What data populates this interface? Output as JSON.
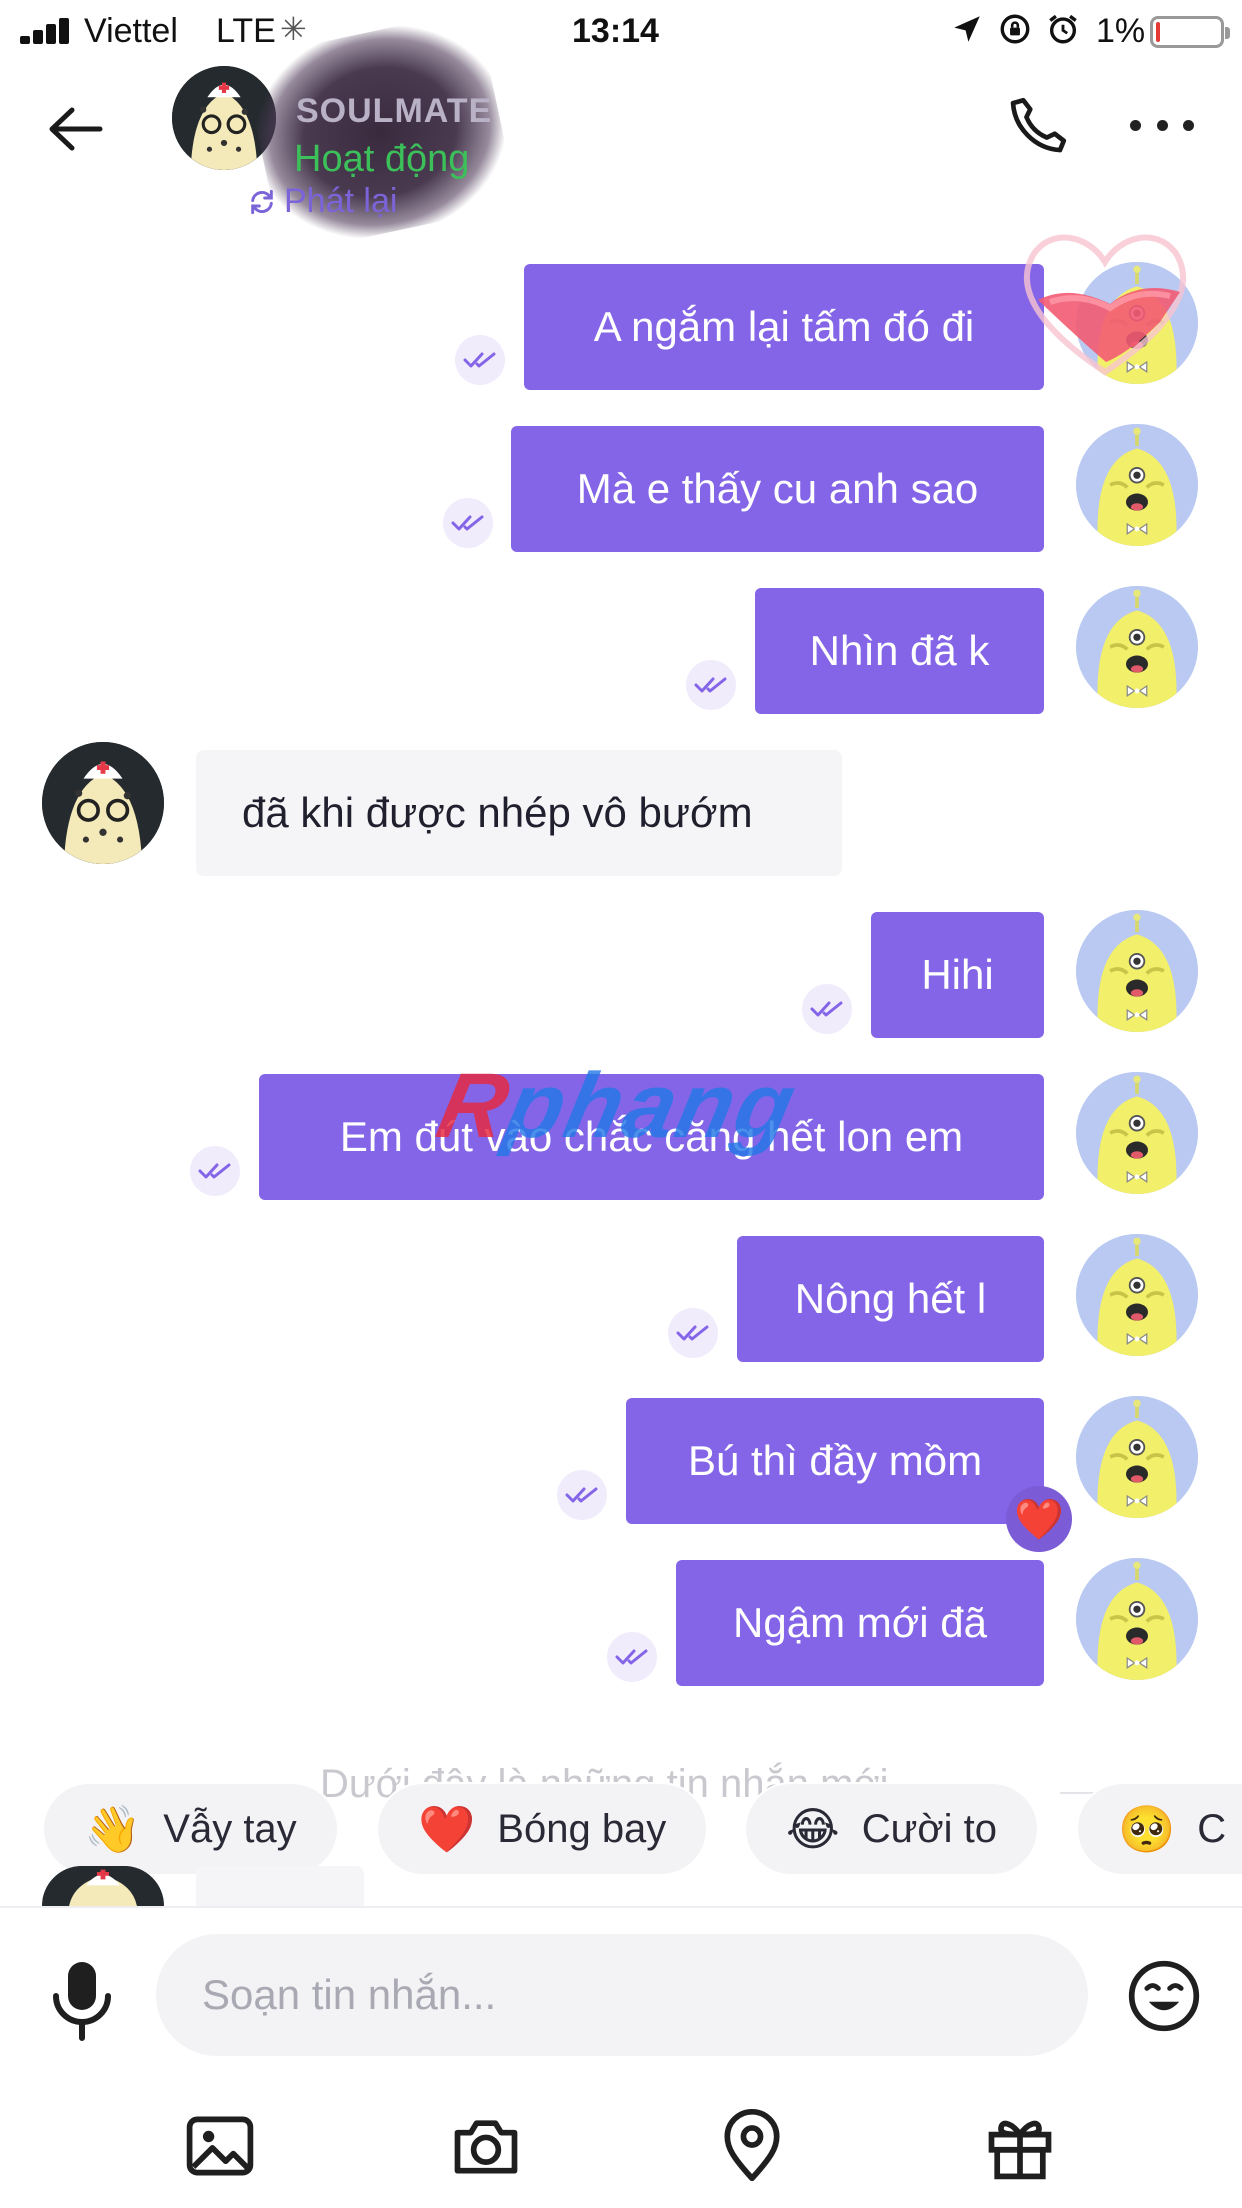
{
  "status_bar": {
    "carrier": "Viettel",
    "network": "LTE",
    "time": "13:14",
    "battery_percent": "1%",
    "battery_level": 0.03,
    "icons": [
      "location-arrow-icon",
      "rotation-lock-icon",
      "alarm-icon"
    ]
  },
  "header": {
    "contact_name": "SOULMATE",
    "presence": "Hoạt động",
    "replay_label": "Phát lại",
    "icons": [
      "back-arrow-icon",
      "phone-icon",
      "more-dots-icon"
    ]
  },
  "colors": {
    "outgoing_bubble": "#8465e8",
    "incoming_bubble": "#f5f5f7",
    "accent": "#7b63d8",
    "online": "#3cc05a"
  },
  "messages": [
    {
      "direction": "outgoing",
      "text": "A ngắm lại tấm đó đi",
      "status_icon": "double-check-icon"
    },
    {
      "direction": "outgoing",
      "text": "Mà e thấy cu anh sao",
      "status_icon": "double-check-icon"
    },
    {
      "direction": "outgoing",
      "text": "Nhìn đã k",
      "status_icon": "double-check-icon"
    },
    {
      "direction": "incoming",
      "text": "đã khi được nhép vô bướm"
    },
    {
      "direction": "outgoing",
      "text": "Hihi",
      "status_icon": "double-check-icon"
    },
    {
      "direction": "outgoing",
      "text": "Em đút vào chắc căng hết lon em",
      "status_icon": "double-check-icon"
    },
    {
      "direction": "outgoing",
      "text": "Nông hết l",
      "status_icon": "double-check-icon"
    },
    {
      "direction": "outgoing",
      "text": "Bú thì đầy mồm",
      "status_icon": "double-check-icon",
      "reaction": "❤️"
    },
    {
      "direction": "outgoing",
      "text": "Ngậm mới đã",
      "status_icon": "double-check-icon"
    }
  ],
  "watermark": {
    "first": "R",
    "rest": "phang"
  },
  "divider_text": "Dưới đây là những tin nhắn mới",
  "quick_replies": [
    {
      "emoji": "👋",
      "label": "Vẫy tay"
    },
    {
      "emoji": "❤️",
      "label": "Bóng bay"
    },
    {
      "emoji": "😂",
      "label": "Cười to"
    },
    {
      "emoji": "🥺",
      "label": "C"
    }
  ],
  "composer": {
    "placeholder": "Soạn tin nhắn...",
    "icons": [
      "microphone-icon",
      "emoji-icon",
      "image-icon",
      "camera-icon",
      "location-pin-icon",
      "gift-icon"
    ]
  }
}
